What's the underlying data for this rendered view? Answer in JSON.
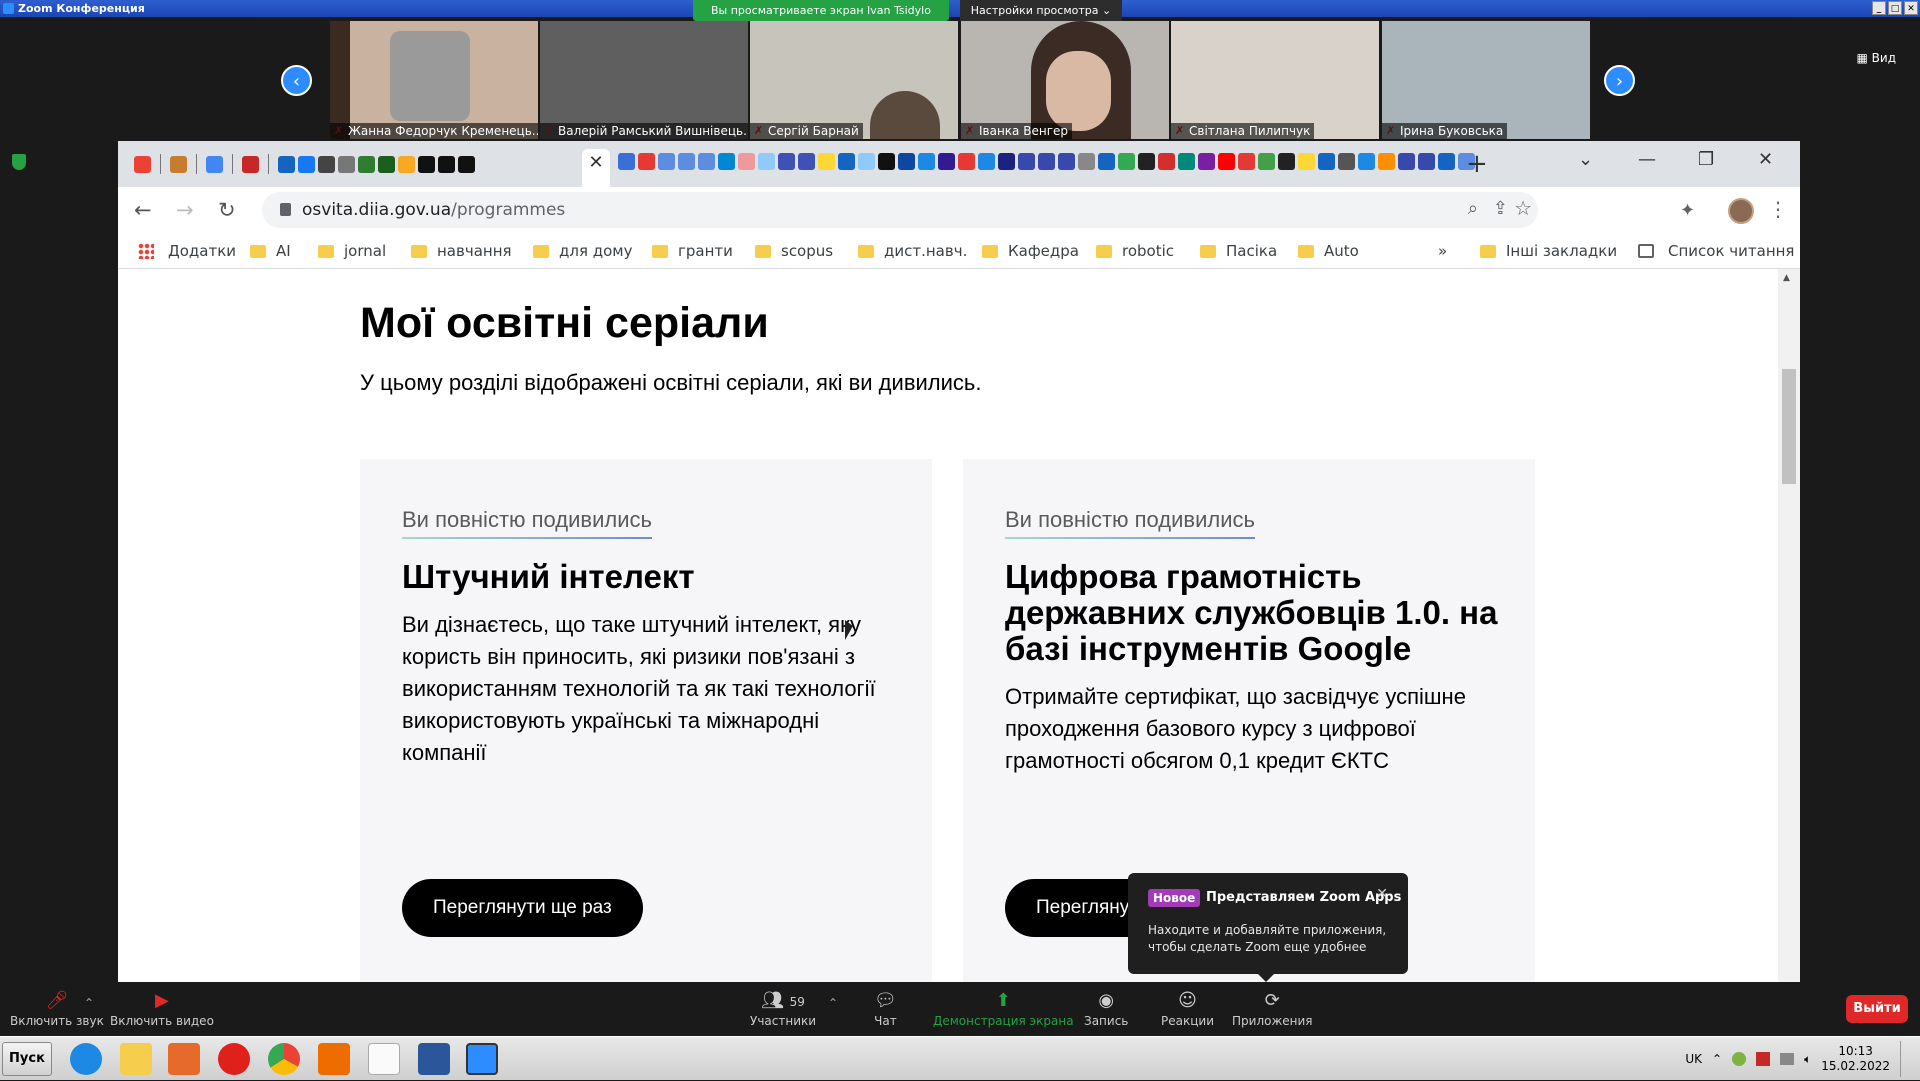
{
  "zoom": {
    "window_title": "Zoom Конференция",
    "share_banner": "Вы просматриваете экран Ivan Tsidylo",
    "view_settings": "Настройки просмотра ⌄",
    "view_label": "Вид",
    "participants": [
      {
        "name": "Жанна Федорчук Кременець..."
      },
      {
        "name": "Валерій Рамський Вишнівець..."
      },
      {
        "name": "Сергій Барнай"
      },
      {
        "name": "Іванка Венгер"
      },
      {
        "name": "Світлана Пилипчук"
      },
      {
        "name": "Ірина Буковська"
      }
    ],
    "toolbar": {
      "mute": "Включить звук",
      "video": "Включить видео",
      "participants": "Участники",
      "participants_count": "59",
      "chat": "Чат",
      "share": "Демонстрация экрана",
      "record": "Запись",
      "reactions": "Реакции",
      "apps": "Приложения",
      "leave": "Выйти"
    },
    "toast": {
      "badge": "Новое",
      "title": "Представляем Zoom Apps",
      "message": "Находите и добавляйте приложения, чтобы сделать Zoom еще удобнее"
    }
  },
  "browser": {
    "url_host": "osvita.diia.gov.ua",
    "url_path": "/programmes",
    "bookmarks": [
      {
        "label": "Додатки"
      },
      {
        "label": "AI"
      },
      {
        "label": "jornal"
      },
      {
        "label": "навчання"
      },
      {
        "label": "для дому"
      },
      {
        "label": "гранти"
      },
      {
        "label": "scopus"
      },
      {
        "label": "дист.навч."
      },
      {
        "label": "Кафедра"
      },
      {
        "label": "robotic"
      },
      {
        "label": "Пасіка"
      },
      {
        "label": "Auto"
      }
    ],
    "more": "»",
    "other_bookmarks": "Інші закладки",
    "reading_list": "Список читання"
  },
  "page": {
    "title": "Мої освітні серіали",
    "subtitle": "У цьому розділі відображені освітні серіали, які ви дивились.",
    "cards": [
      {
        "tag": "Ви повністю подивились",
        "title": "Штучний інтелект",
        "text": "Ви дізнаєтесь, що таке штучний інтелект, яку користь він приносить, які ризики пов'язані з використанням технологій та як такі технології використовують українські та міжнародні компанії",
        "button": "Переглянути ще раз"
      },
      {
        "tag": "Ви повністю подивились",
        "title": "Цифрова грамотність державних службовців 1.0. на базі інструментів Google",
        "text": "Отримайте сертифікат, що засвідчує успішне проходження базового курсу з цифрової грамотності обсягом 0,1 кредит ЄКТС",
        "button": "Переглянути ще раз"
      }
    ]
  },
  "taskbar": {
    "start": "Пуск",
    "lang": "UK",
    "time": "10:13",
    "date": "15.02.2022"
  }
}
